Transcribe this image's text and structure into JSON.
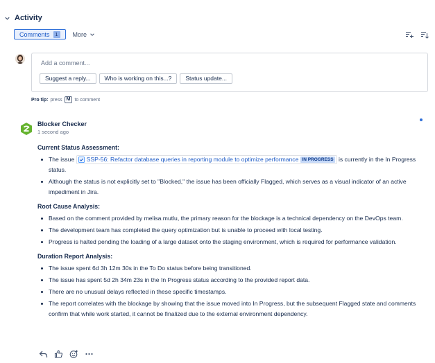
{
  "section": {
    "title": "Activity"
  },
  "tabs": {
    "comments_label": "Comments",
    "comments_count": "1",
    "more_label": "More"
  },
  "composer": {
    "placeholder": "Add a comment...",
    "suggestions": [
      "Suggest a reply...",
      "Who is working on this...?",
      "Status update..."
    ]
  },
  "protip": {
    "prefix": "Pro tip:",
    "press": "press",
    "key": "M",
    "suffix": "to comment"
  },
  "comment": {
    "author": "Blocker Checker",
    "time": "1 second ago",
    "sections": [
      {
        "heading": "Current Status Assessment:",
        "issue_prefix": "The issue",
        "issue_link": "SSP-56: Refactor database queries in reporting module to optimize performance",
        "issue_status": "IN PROGRESS",
        "issue_suffix": "is currently in the In Progress status.",
        "bullet2": "Although the status is not explicitly set to \"Blocked,\" the issue has been officially Flagged, which serves as a visual indicator of an active impediment in Jira."
      },
      {
        "heading": "Root Cause Analysis:",
        "bullets": [
          "Based on the comment provided by melisa.mutlu, the primary reason for the blockage is a technical dependency on the DevOps team.",
          "The development team has completed the query optimization but is unable to proceed with local testing.",
          "Progress is halted pending the loading of a large dataset onto the staging environment, which is required for performance validation."
        ]
      },
      {
        "heading": "Duration Report Analysis:",
        "bullets": [
          "The issue spent 6d 3h 12m 30s in the To Do status before being transitioned.",
          "The issue has spent 5d 2h 34m 23s in the In Progress status according to the provided report data.",
          "There are no unusual delays reflected in these specific timestamps.",
          "The report correlates with the blockage by showing that the issue moved into In Progress, but the subsequent Flagged state and comments confirm that while work started, it cannot be finalized due to the external environment dependency."
        ]
      }
    ]
  },
  "colors": {
    "accent": "#2f6fd8",
    "text": "#172b4d",
    "muted": "#6b778c",
    "bot_green": "#65b32e"
  },
  "icons": [
    "chevron-down-icon",
    "sort-add-icon",
    "sort-order-icon",
    "reply-icon",
    "thumbs-up-icon",
    "emoji-icon",
    "more-icon",
    "checkbox-issue-icon"
  ]
}
